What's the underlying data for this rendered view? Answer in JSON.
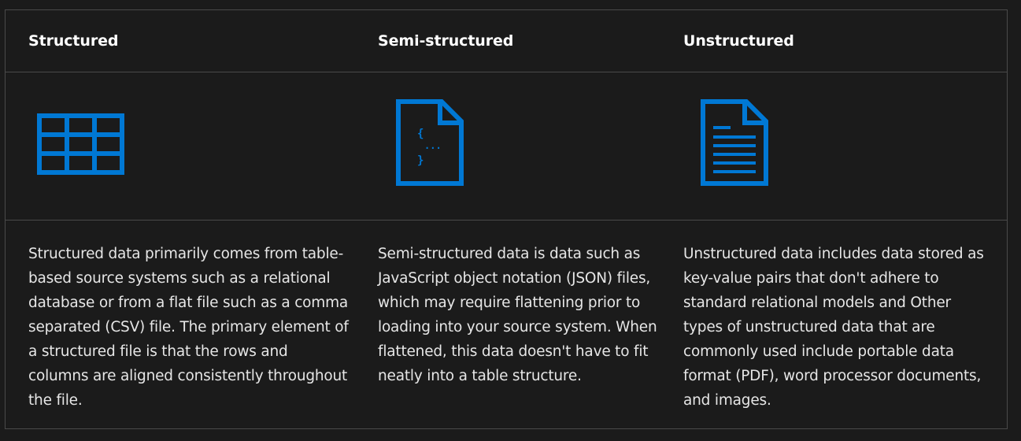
{
  "columns": [
    {
      "heading": "Structured",
      "icon": "table-grid-icon",
      "description": "Structured data primarily comes from table-based source systems such as a relational database or from a flat file such as a comma separated (CSV) file. The primary element of a structured file is that the rows and columns are aligned consistently throughout the file."
    },
    {
      "heading": "Semi-structured",
      "icon": "json-document-icon",
      "icon_glyphs": [
        "{",
        "...",
        "}"
      ],
      "description": "Semi-structured data is data such as JavaScript object notation (JSON) files, which may require flattening prior to loading into your source system. When flattened, this data doesn't have to fit neatly into a table structure."
    },
    {
      "heading": "Unstructured",
      "icon": "text-document-icon",
      "description": "Unstructured data includes data stored as key-value pairs that don't adhere to standard relational models and Other types of unstructured data that are commonly used include portable data format (PDF), word processor documents, and images."
    }
  ],
  "colors": {
    "background": "#1b1b1b",
    "border": "#4a4a4a",
    "icon_blue": "#0078d4",
    "heading": "#ffffff",
    "text": "#e6e6e6"
  }
}
